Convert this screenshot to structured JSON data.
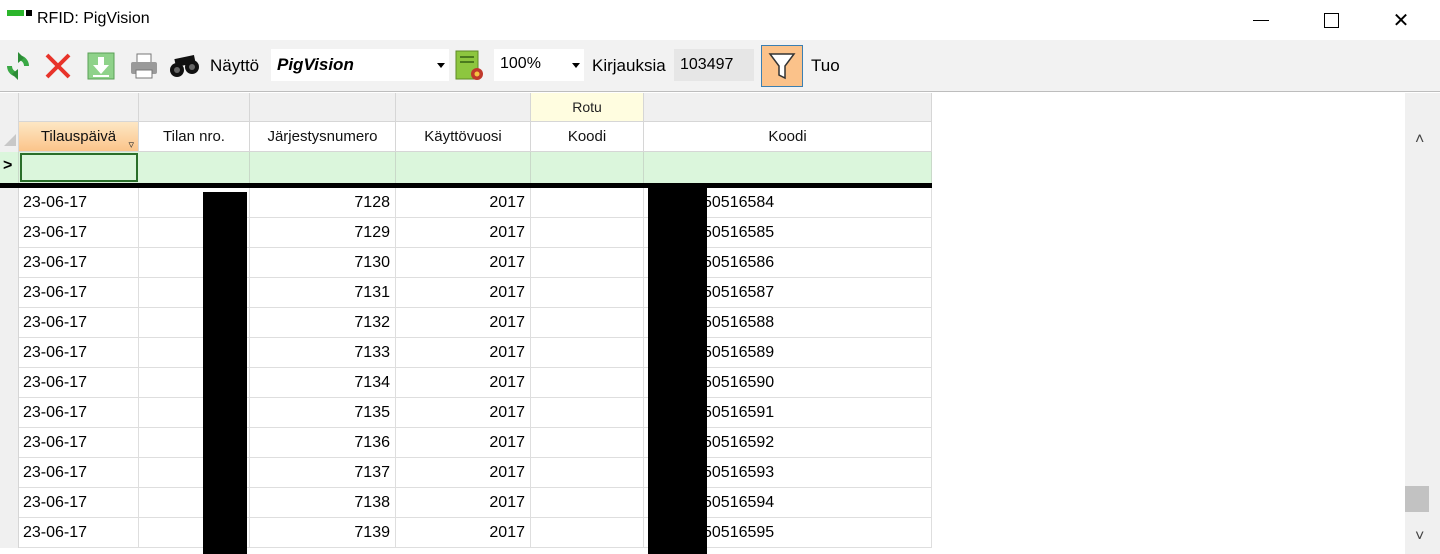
{
  "window": {
    "title": "RFID: PigVision",
    "minimize_glyph": "",
    "maximize_glyph": "",
    "close_glyph": "✕"
  },
  "toolbar": {
    "icons": [
      "refresh-icon",
      "delete-icon",
      "download-icon",
      "print-icon",
      "binoculars-icon",
      "report-settings-icon",
      "filter-icon"
    ],
    "view_label": "Näyttö",
    "view_value": "PigVision",
    "zoom_value": "100%",
    "records_label": "Kirjauksia",
    "records_count": "103497",
    "import_label": "Tuo"
  },
  "grid": {
    "group_header": "Rotu",
    "columns": [
      "Tilauspäivä",
      "Tilan nro.",
      "Järjestysnumero",
      "Käyttövuosi",
      "Koodi",
      "Koodi"
    ],
    "new_row_indicator": ">",
    "rows": [
      {
        "date": "23-06-17",
        "tila": "",
        "jarj": "7128",
        "vuosi": "2017",
        "rotu": "",
        "koodi": "50516584"
      },
      {
        "date": "23-06-17",
        "tila": "",
        "jarj": "7129",
        "vuosi": "2017",
        "rotu": "",
        "koodi": "50516585"
      },
      {
        "date": "23-06-17",
        "tila": "",
        "jarj": "7130",
        "vuosi": "2017",
        "rotu": "",
        "koodi": "50516586"
      },
      {
        "date": "23-06-17",
        "tila": "",
        "jarj": "7131",
        "vuosi": "2017",
        "rotu": "",
        "koodi": "50516587"
      },
      {
        "date": "23-06-17",
        "tila": "",
        "jarj": "7132",
        "vuosi": "2017",
        "rotu": "",
        "koodi": "50516588"
      },
      {
        "date": "23-06-17",
        "tila": "",
        "jarj": "7133",
        "vuosi": "2017",
        "rotu": "",
        "koodi": "50516589"
      },
      {
        "date": "23-06-17",
        "tila": "",
        "jarj": "7134",
        "vuosi": "2017",
        "rotu": "",
        "koodi": "50516590"
      },
      {
        "date": "23-06-17",
        "tila": "",
        "jarj": "7135",
        "vuosi": "2017",
        "rotu": "",
        "koodi": "50516591"
      },
      {
        "date": "23-06-17",
        "tila": "",
        "jarj": "7136",
        "vuosi": "2017",
        "rotu": "",
        "koodi": "50516592"
      },
      {
        "date": "23-06-17",
        "tila": "",
        "jarj": "7137",
        "vuosi": "2017",
        "rotu": "",
        "koodi": "50516593"
      },
      {
        "date": "23-06-17",
        "tila": "",
        "jarj": "7138",
        "vuosi": "2017",
        "rotu": "",
        "koodi": "50516594"
      },
      {
        "date": "23-06-17",
        "tila": "",
        "jarj": "7139",
        "vuosi": "2017",
        "rotu": "",
        "koodi": "50516595"
      }
    ]
  },
  "scrollbar": {
    "up_glyph": "˄",
    "down_glyph": "˅"
  },
  "colors": {
    "new_row_bg": "#dbf6dc",
    "sorted_header": "#fbc48a",
    "filter_active": "#fbc28a",
    "rotu_header": "#fffde0"
  }
}
